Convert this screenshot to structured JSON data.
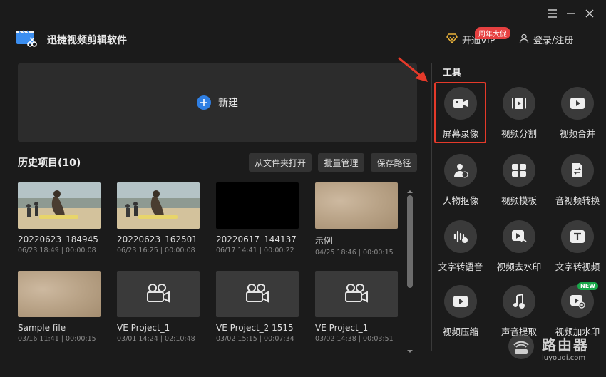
{
  "window": {
    "menu_icon": "hamburger-icon",
    "minimize_icon": "minimize-icon",
    "close_icon": "close-icon"
  },
  "app": {
    "title": "迅捷视频剪辑软件",
    "logo_icon": "clapperboard-scissors-icon"
  },
  "header": {
    "vip_label": "开通VIP",
    "vip_badge": "周年大促",
    "login_label": "登录/注册"
  },
  "new_project": {
    "label": "新建"
  },
  "history": {
    "title": "历史项目(10)",
    "buttons": [
      "从文件夹打开",
      "批量管理",
      "保存路径"
    ],
    "items": [
      {
        "name": "20220623_184945",
        "date": "06/23 18:49",
        "duration": "00:00:08",
        "thumb": "beach"
      },
      {
        "name": "20220623_162501",
        "date": "06/23 16:25",
        "duration": "00:00:08",
        "thumb": "beach"
      },
      {
        "name": "20220617_144137",
        "date": "06/17 14:41",
        "duration": "00:00:22",
        "thumb": "black"
      },
      {
        "name": "示例",
        "date": "04/25 18:46",
        "duration": "00:00:15",
        "thumb": "sand"
      },
      {
        "name": "Sample file",
        "date": "03/16 11:41",
        "duration": "00:00:15",
        "thumb": "sand"
      },
      {
        "name": "VE Project_1",
        "date": "03/01 14:24",
        "duration": "02:10:48",
        "thumb": "project"
      },
      {
        "name": "VE Project_2 1515",
        "date": "03/02 15:15",
        "duration": "00:07:34",
        "thumb": "project"
      },
      {
        "name": "VE Project_1",
        "date": "03/02 14:38",
        "duration": "00:03:51",
        "thumb": "project"
      }
    ]
  },
  "tools": {
    "title": "工具",
    "items": [
      {
        "label": "屏幕录像",
        "icon": "screen-record-icon"
      },
      {
        "label": "视频分割",
        "icon": "video-split-icon"
      },
      {
        "label": "视频合并",
        "icon": "video-merge-icon"
      },
      {
        "label": "人物抠像",
        "icon": "portrait-cutout-icon"
      },
      {
        "label": "视频模板",
        "icon": "video-template-icon"
      },
      {
        "label": "音视频转换",
        "icon": "av-convert-icon"
      },
      {
        "label": "文字转语音",
        "icon": "text-to-speech-icon"
      },
      {
        "label": "视频去水印",
        "icon": "remove-watermark-icon"
      },
      {
        "label": "文字转视频",
        "icon": "text-to-video-icon"
      },
      {
        "label": "视频压缩",
        "icon": "video-compress-icon"
      },
      {
        "label": "声音提取",
        "icon": "audio-extract-icon"
      },
      {
        "label": "视频加水印",
        "icon": "add-watermark-icon"
      }
    ],
    "new_badge": "NEW"
  },
  "watermark": {
    "text_cn": "路由器",
    "text_en": "luyouqi.com"
  },
  "colors": {
    "accent_blue": "#2f7fe3",
    "highlight_red": "#e53a2a",
    "new_green": "#19a84a",
    "vip_red": "#e64040",
    "background": "#1b1b1b"
  }
}
